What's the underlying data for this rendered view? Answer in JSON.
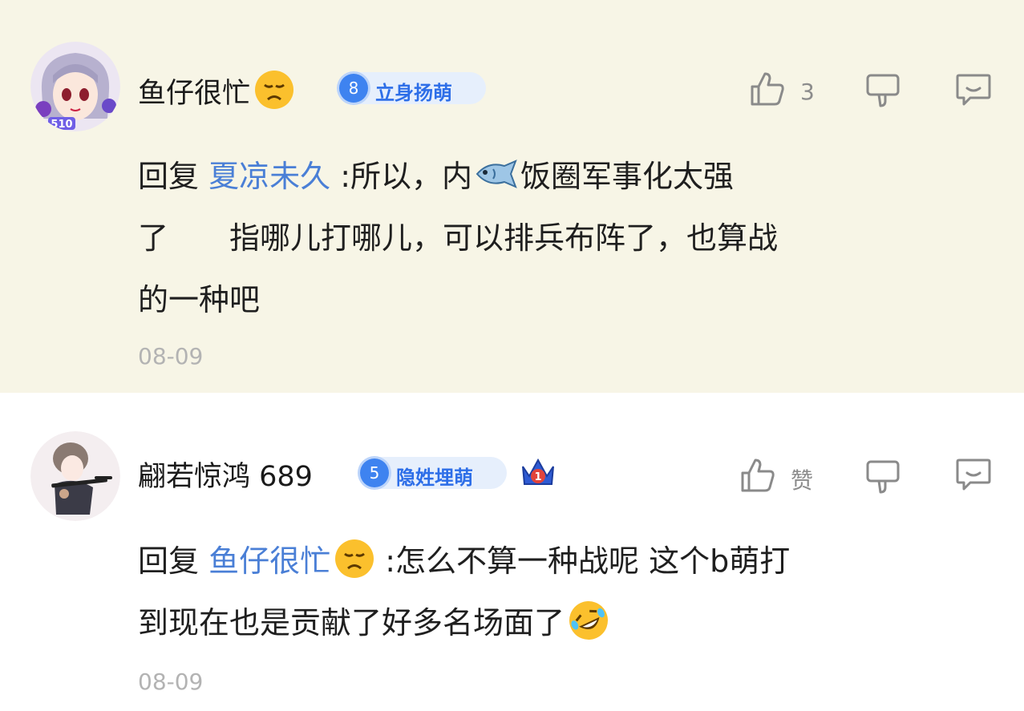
{
  "comments": [
    {
      "username": "鱼仔很忙",
      "username_emoji": "disappointed-face",
      "level": "8",
      "badge": "立身扬萌",
      "avatar_tag": "510",
      "like_count": "3",
      "reply_prefix": "回复",
      "mention": "夏凉未久",
      "text_a": ":所以，内",
      "inline_emoji": "fish",
      "text_b": "饭圈军事化太强",
      "line2": "了　　指哪儿打哪儿，可以排兵布阵了，也算战",
      "line3": "的一种吧",
      "date": "08-09"
    },
    {
      "username": "翩若惊鸿 689",
      "level": "5",
      "badge": "隐姓埋萌",
      "rank_badge": "1",
      "like_label": "赞",
      "reply_prefix": "回复",
      "mention": "鱼仔很忙",
      "mention_emoji": "disappointed-face",
      "text_a": ":怎么不算一种战呢 这个b萌打",
      "line2": "到现在也是贡献了好多名场面了",
      "line2_emoji": "rolling-on-floor-laughing",
      "date": "08-09"
    }
  ],
  "colors": {
    "highlight_bg": "#f7f5e6",
    "mention": "#4a7fd6",
    "badge_bg": "#e6effc",
    "badge_text": "#2d6ee8",
    "level_circle": "#3e83f0",
    "meta_gray": "#b3b3b3"
  }
}
